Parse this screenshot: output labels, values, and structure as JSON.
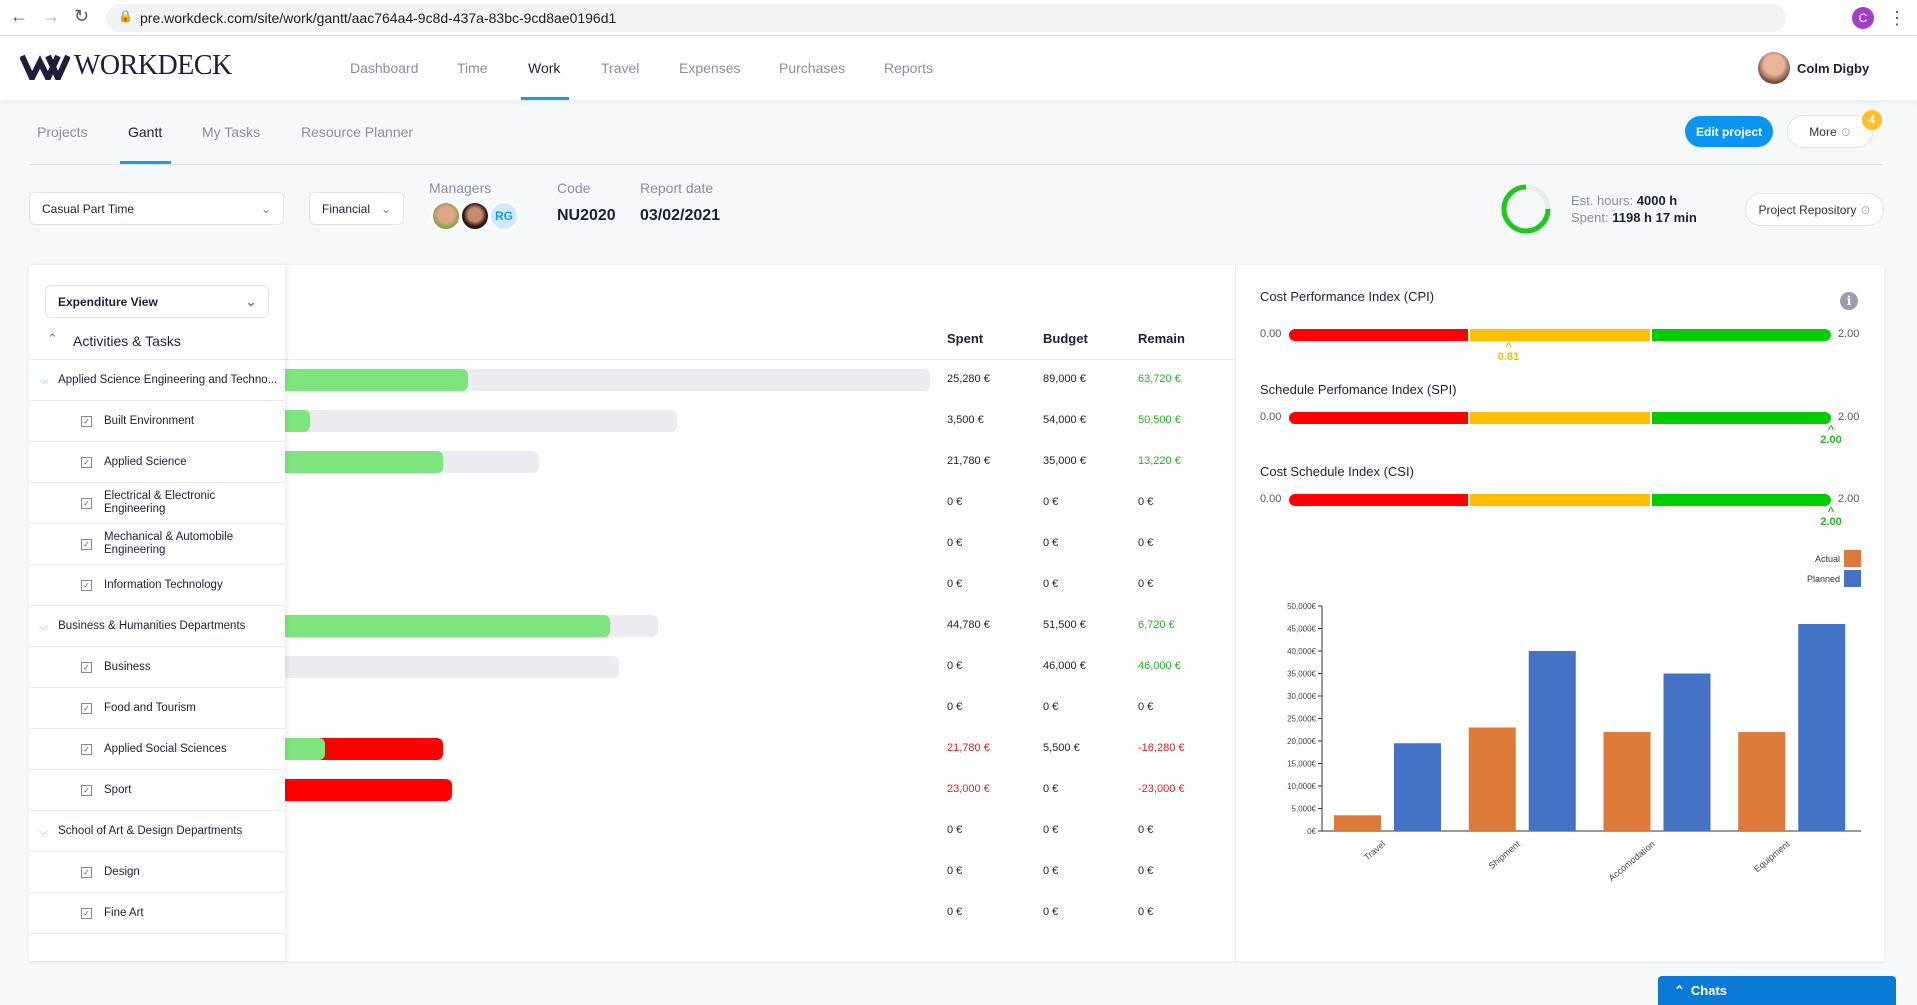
{
  "browser": {
    "url": "pre.workdeck.com/site/work/gantt/aac764a4-9c8d-437a-83bc-9cd8ae0196d1",
    "profile_initial": "C"
  },
  "header": {
    "logo": "WORKDECK",
    "nav": [
      "Dashboard",
      "Time",
      "Work",
      "Travel",
      "Expenses",
      "Purchases",
      "Reports"
    ],
    "active_nav": "Work",
    "user_name": "Colm Digby"
  },
  "subtabs": {
    "items": [
      "Projects",
      "Gantt",
      "My Tasks",
      "Resource Planner"
    ],
    "active": "Gantt",
    "edit_project": "Edit project",
    "more": "More",
    "more_badge": "4"
  },
  "project": {
    "type_select": "Casual Part Time",
    "view_select": "Financial",
    "managers_label": "Managers",
    "manager_initials": "RG",
    "code_label": "Code",
    "code": "NU2020",
    "report_date_label": "Report date",
    "report_date": "03/02/2021",
    "est_hours_label": "Est. hours:",
    "est_hours": "4000 h",
    "spent_label": "Spent:",
    "spent": "1198 h 17 min",
    "ring_fraction": 0.75,
    "repository": "Project Repository"
  },
  "gantt": {
    "view_select": "Expenditure View",
    "tree_title": "Activities & Tasks",
    "columns": {
      "spent": "Spent",
      "budget": "Budget",
      "remain": "Remain"
    },
    "rows": [
      {
        "label": "Applied Science Engineering and Techno...",
        "group": true,
        "spent": "25,280 €",
        "budget": "89,000 €",
        "remain": "63,720 €",
        "spent_v": 25280,
        "budget_v": 89000
      },
      {
        "label": "Built Environment",
        "group": false,
        "spent": "3,500 €",
        "budget": "54,000 €",
        "remain": "50,500 €",
        "spent_v": 3500,
        "budget_v": 54000
      },
      {
        "label": "Applied Science",
        "group": false,
        "spent": "21,780 €",
        "budget": "35,000 €",
        "remain": "13,220 €",
        "spent_v": 21780,
        "budget_v": 35000
      },
      {
        "label": "Electrical & Electronic Engineering",
        "group": false,
        "spent": "0 €",
        "budget": "0 €",
        "remain": "0 €",
        "spent_v": 0,
        "budget_v": 0
      },
      {
        "label": "Mechanical & Automobile Engineering",
        "group": false,
        "spent": "0 €",
        "budget": "0 €",
        "remain": "0 €",
        "spent_v": 0,
        "budget_v": 0
      },
      {
        "label": "Information Technology",
        "group": false,
        "spent": "0 €",
        "budget": "0 €",
        "remain": "0 €",
        "spent_v": 0,
        "budget_v": 0
      },
      {
        "label": "Business & Humanities Departments",
        "group": true,
        "spent": "44,780 €",
        "budget": "51,500 €",
        "remain": "6,720 €",
        "spent_v": 44780,
        "budget_v": 51500
      },
      {
        "label": "Business",
        "group": false,
        "spent": "0 €",
        "budget": "46,000 €",
        "remain": "46,000 €",
        "spent_v": 0,
        "budget_v": 46000
      },
      {
        "label": "Food and Tourism",
        "group": false,
        "spent": "0 €",
        "budget": "0 €",
        "remain": "0 €",
        "spent_v": 0,
        "budget_v": 0
      },
      {
        "label": "Applied Social Sciences",
        "group": false,
        "spent": "21,780 €",
        "budget": "5,500 €",
        "remain": "-16,280 €",
        "spent_v": 21780,
        "budget_v": 5500
      },
      {
        "label": "Sport",
        "group": false,
        "spent": "23,000 €",
        "budget": "0 €",
        "remain": "-23,000 €",
        "spent_v": 23000,
        "budget_v": 0
      },
      {
        "label": "School of Art & Design Departments",
        "group": true,
        "spent": "0 €",
        "budget": "0 €",
        "remain": "0 €",
        "spent_v": 0,
        "budget_v": 0
      },
      {
        "label": "Design",
        "group": false,
        "spent": "0 €",
        "budget": "0 €",
        "remain": "0 €",
        "spent_v": 0,
        "budget_v": 0
      },
      {
        "label": "Fine Art",
        "group": false,
        "spent": "0 €",
        "budget": "0 €",
        "remain": "0 €",
        "spent_v": 0,
        "budget_v": 0
      }
    ]
  },
  "indices": [
    {
      "title": "Cost Performance Index (CPI)",
      "min": "0.00",
      "max": "2.00",
      "value": "0.81",
      "value_num": 0.81,
      "color": "#f5b800"
    },
    {
      "title": "Schedule Perfomance Index (SPI)",
      "min": "0.00",
      "max": "2.00",
      "value": "2.00",
      "value_num": 2.0,
      "color": "#22bb22"
    },
    {
      "title": "Cost Schedule Index (CSI)",
      "min": "0.00",
      "max": "2.00",
      "value": "2.00",
      "value_num": 2.0,
      "color": "#22bb22"
    }
  ],
  "colors": {
    "red": "#ff0000",
    "amber": "#ffbf00",
    "green": "#00cc00",
    "accent": "#1a9be6",
    "gantt_green": "#7ee57e",
    "gantt_gray": "#ececf0"
  },
  "chart_data": {
    "type": "bar",
    "categories": [
      "Travel",
      "Shipment",
      "Accomodation",
      "Equipment"
    ],
    "series": [
      {
        "name": "Actual",
        "color": "#dd7a39",
        "values": [
          3500,
          23000,
          22000,
          22000
        ]
      },
      {
        "name": "Planned",
        "color": "#4472c4",
        "values": [
          19500,
          40000,
          35000,
          46000
        ]
      }
    ],
    "ylim": [
      0,
      50000
    ],
    "yticks": [
      "0€",
      "5,000€",
      "10,000€",
      "15,000€",
      "20,000€",
      "25,000€",
      "30,000€",
      "35,000€",
      "40,000€",
      "45,000€",
      "50,000€"
    ],
    "legend": "top-right",
    "grid": false
  },
  "chats": "Chats"
}
